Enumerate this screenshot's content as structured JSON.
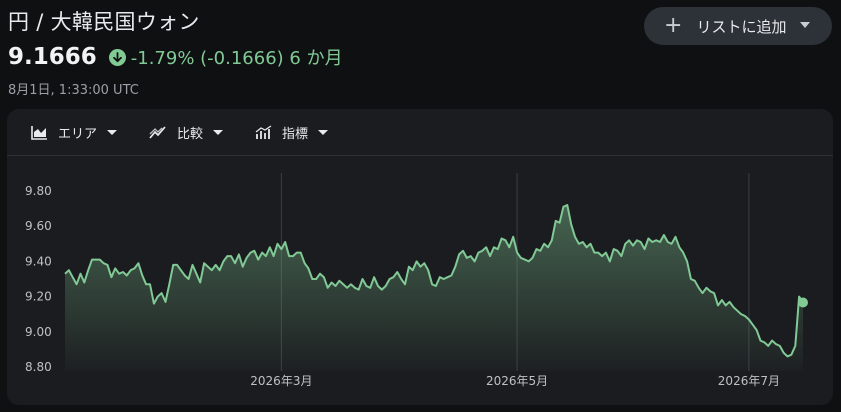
{
  "header": {
    "title": "円 / 大韓民国ウォン",
    "add_button_label": "リストに追加"
  },
  "quote": {
    "price": "9.1666",
    "change": "-1.79% (-0.1666) 6 か月",
    "timestamp": "8月1日, 1:33:00 UTC"
  },
  "toolbar": {
    "items": [
      {
        "label": "エリア",
        "icon": "area-chart-icon"
      },
      {
        "label": "比較",
        "icon": "compare-icon"
      },
      {
        "label": "指標",
        "icon": "indicators-icon"
      }
    ]
  },
  "colors": {
    "accent_green": "#81c995",
    "background": "#0f1012",
    "card": "#1b1c1f"
  },
  "chart_data": {
    "type": "area",
    "x_tick_labels": [
      "2026年3月",
      "2026年5月",
      "2026年7月"
    ],
    "y_tick_labels": [
      "9.80",
      "9.60",
      "9.40",
      "9.20",
      "9.00",
      "8.80"
    ],
    "ylim": [
      8.8,
      9.8
    ],
    "grid": "vertical lines at month ticks",
    "series": [
      {
        "values": [
          9.33,
          9.35,
          9.31,
          9.27,
          9.33,
          9.28,
          9.35,
          9.41,
          9.41,
          9.41,
          9.39,
          9.38,
          9.31,
          9.36,
          9.33,
          9.34,
          9.32,
          9.35,
          9.36,
          9.39,
          9.32,
          9.27,
          9.27,
          9.16,
          9.2,
          9.22,
          9.17,
          9.27,
          9.38,
          9.38,
          9.35,
          9.32,
          9.3,
          9.38,
          9.33,
          9.28,
          9.39,
          9.37,
          9.35,
          9.38,
          9.35,
          9.4,
          9.43,
          9.43,
          9.39,
          9.44,
          9.37,
          9.42,
          9.45,
          9.46,
          9.41,
          9.45,
          9.43,
          9.48,
          9.43,
          9.5,
          9.47,
          9.51,
          9.43,
          9.43,
          9.45,
          9.45,
          9.39,
          9.36,
          9.3,
          9.3,
          9.33,
          9.31,
          9.25,
          9.28,
          9.26,
          9.29,
          9.27,
          9.25,
          9.27,
          9.25,
          9.24,
          9.3,
          9.26,
          9.25,
          9.31,
          9.26,
          9.24,
          9.26,
          9.3,
          9.31,
          9.34,
          9.3,
          9.27,
          9.37,
          9.35,
          9.4,
          9.37,
          9.39,
          9.35,
          9.27,
          9.26,
          9.31,
          9.3,
          9.31,
          9.32,
          9.37,
          9.44,
          9.46,
          9.42,
          9.43,
          9.4,
          9.45,
          9.46,
          9.48,
          9.43,
          9.48,
          9.47,
          9.53,
          9.52,
          9.48,
          9.54,
          9.45,
          9.42,
          9.41,
          9.4,
          9.42,
          9.47,
          9.46,
          9.5,
          9.48,
          9.52,
          9.63,
          9.62,
          9.71,
          9.72,
          9.61,
          9.54,
          9.5,
          9.51,
          9.48,
          9.5,
          9.45,
          9.45,
          9.43,
          9.45,
          9.4,
          9.47,
          9.46,
          9.43,
          9.5,
          9.52,
          9.49,
          9.52,
          9.51,
          9.47,
          9.53,
          9.51,
          9.52,
          9.51,
          9.55,
          9.51,
          9.5,
          9.54,
          9.48,
          9.45,
          9.4,
          9.3,
          9.29,
          9.25,
          9.22,
          9.25,
          9.23,
          9.22,
          9.15,
          9.18,
          9.15,
          9.17,
          9.14,
          9.12,
          9.1,
          9.09,
          9.07,
          9.04,
          9.01,
          8.95,
          8.94,
          8.92,
          8.95,
          8.93,
          8.92,
          8.88,
          8.86,
          8.87,
          8.92,
          9.2,
          9.1666
        ]
      }
    ]
  }
}
